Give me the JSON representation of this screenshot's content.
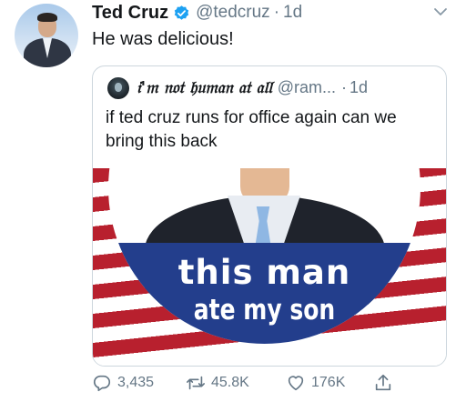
{
  "tweet": {
    "author_name": "Ted Cruz",
    "handle": "@tedcruz",
    "separator": "·",
    "time": "1d",
    "text": "He was delicious!",
    "verified": true
  },
  "quoted_tweet": {
    "author_name": "𝔦'𝔪 𝔫𝔬𝔱 𝔥𝔲𝔪𝔞𝔫 𝔞𝔱 𝔞𝔩𝔩",
    "handle": "@ram...",
    "separator": "·",
    "time": "1d",
    "text": "if ted cruz runs for office again can we bring this back",
    "image_text_line1": "this man",
    "image_text_line2": "ate my son"
  },
  "actions": {
    "replies": "3,435",
    "retweets": "45.8K",
    "likes": "176K"
  },
  "icons": [
    "verified-badge-icon",
    "chevron-down-icon",
    "reply-icon",
    "retweet-icon",
    "like-icon",
    "share-icon"
  ],
  "colors": {
    "verified": "#1da1f2",
    "secondary_text": "#657786",
    "border": "#ccd6dd",
    "flag_red": "#b8202e",
    "button_blue": "#233e8c"
  }
}
